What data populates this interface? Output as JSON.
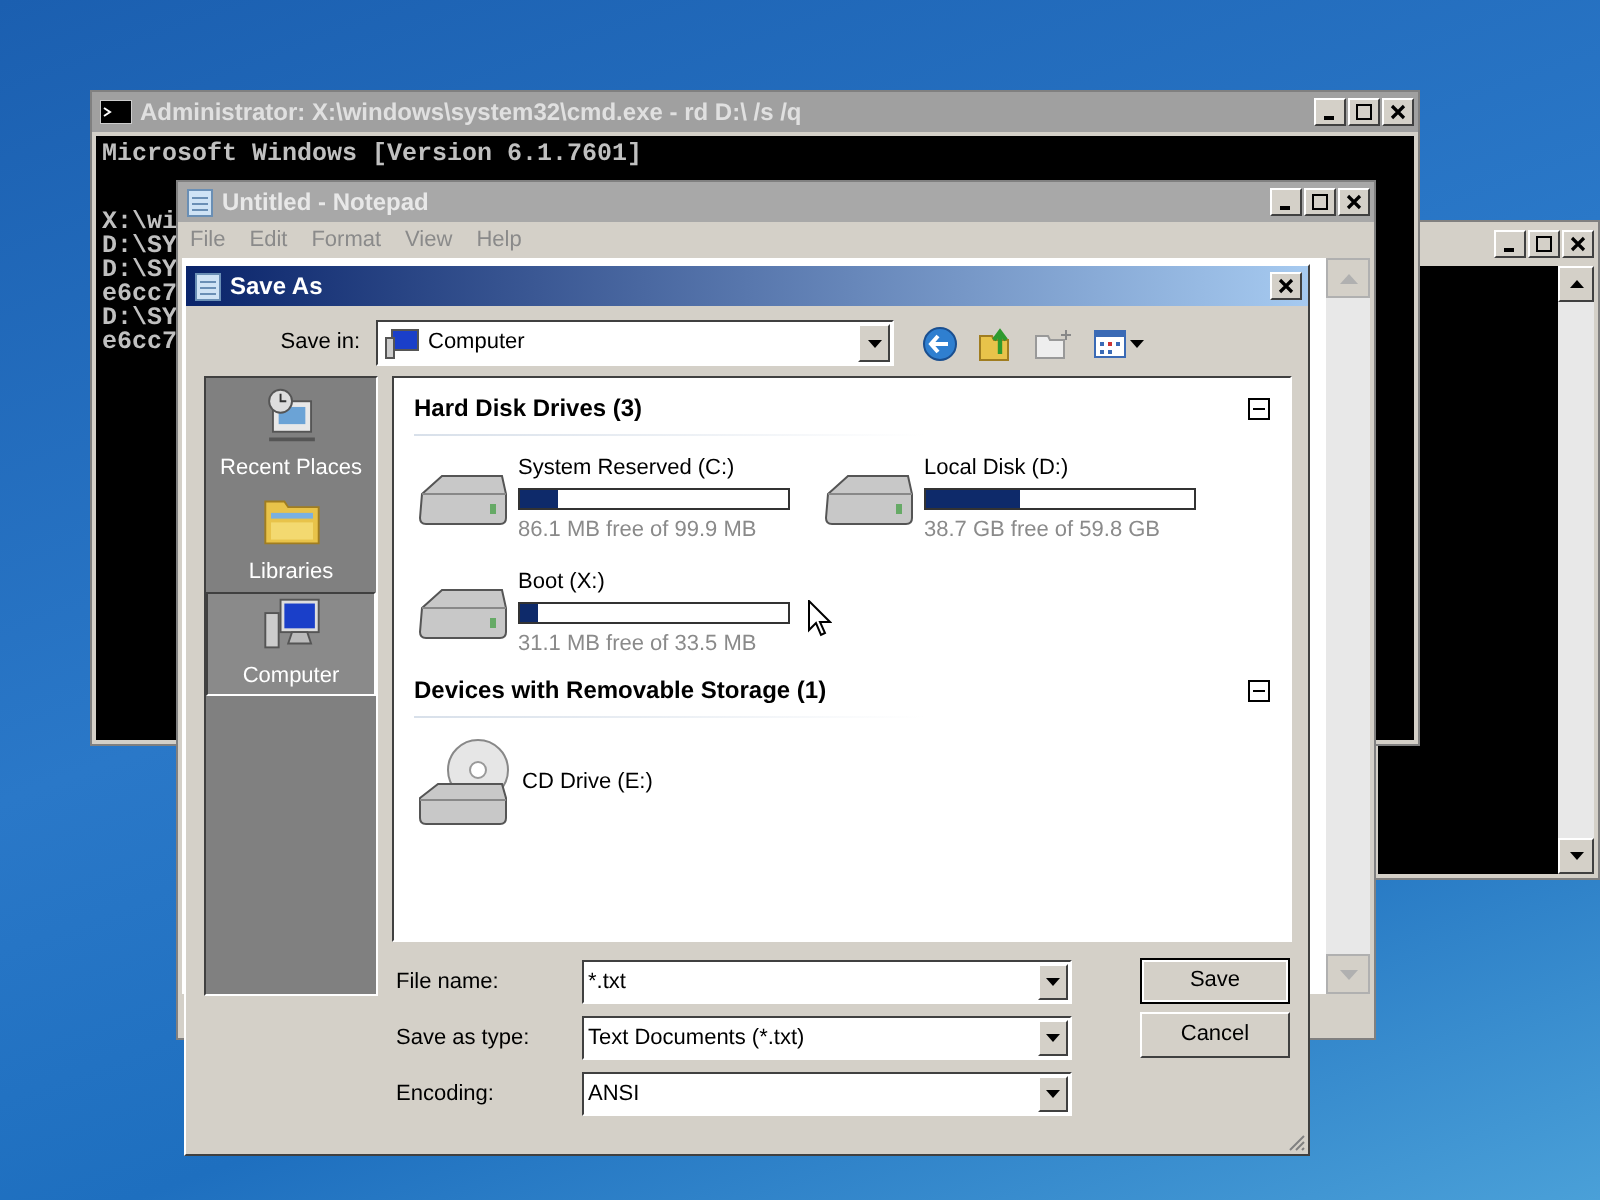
{
  "cmd_window": {
    "title": "Administrator: X:\\windows\\system32\\cmd.exe - rd  D:\\ /s /q",
    "header_line": "Microsoft Windows [Version 6.1.7601]",
    "lines": [
      "X:\\wi",
      "D:\\SY",
      "D:\\SY",
      "e6cc7",
      "D:\\SY",
      "e6cc7"
    ]
  },
  "notepad": {
    "title": "Untitled - Notepad",
    "menu": [
      "File",
      "Edit",
      "Format",
      "View",
      "Help"
    ]
  },
  "save_as": {
    "title": "Save As",
    "save_in": {
      "label": "Save in:",
      "value": "Computer"
    },
    "places": [
      {
        "kind": "recent",
        "label": "Recent Places",
        "selected": false
      },
      {
        "kind": "libraries",
        "label": "Libraries",
        "selected": false
      },
      {
        "kind": "computer",
        "label": "Computer",
        "selected": true
      }
    ],
    "groups": [
      {
        "title": "Hard Disk Drives (3)",
        "expanded": true,
        "items": [
          {
            "kind": "disk",
            "name": "System Reserved (C:)",
            "level": 0.14,
            "free": "86.1 MB free of 99.9 MB"
          },
          {
            "kind": "disk",
            "name": "Local Disk (D:)",
            "level": 0.35,
            "free": "38.7 GB free of 59.8 GB"
          },
          {
            "kind": "disk",
            "name": "Boot (X:)",
            "level": 0.07,
            "free": "31.1 MB free of 33.5 MB"
          }
        ]
      },
      {
        "title": "Devices with Removable Storage (1)",
        "expanded": true,
        "items": [
          {
            "kind": "cd",
            "name": "CD Drive (E:)"
          }
        ]
      }
    ],
    "fields": [
      {
        "label": "File name:",
        "value": "*.txt"
      },
      {
        "label": "Save as type:",
        "value": "Text Documents (*.txt)"
      },
      {
        "label": "Encoding:",
        "value": "ANSI"
      }
    ],
    "buttons": [
      {
        "label": "Save",
        "default": true
      },
      {
        "label": "Cancel",
        "default": false
      }
    ]
  }
}
